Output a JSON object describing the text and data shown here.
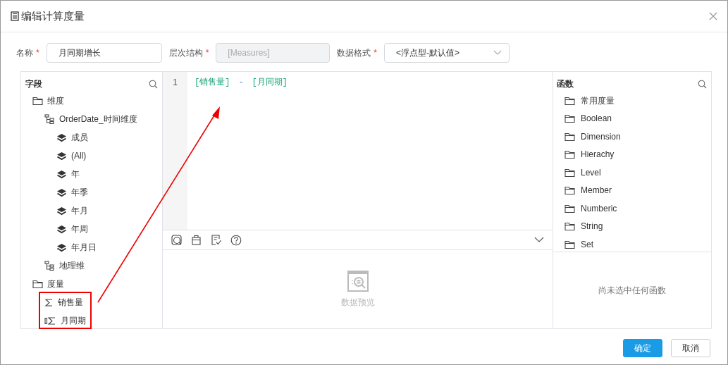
{
  "window": {
    "title": "编辑计算度量"
  },
  "form": [
    {
      "label": "名称",
      "required_mark": "*",
      "kind": "input",
      "value": "月同期增长",
      "disabled": false
    },
    {
      "label": "层次结构",
      "required_mark": "*",
      "kind": "input",
      "value": "[Measures]",
      "disabled": true
    },
    {
      "label": "数据格式",
      "required_mark": "*",
      "kind": "select",
      "value": "<浮点型-默认值>",
      "disabled": false
    }
  ],
  "fields": {
    "title": "字段",
    "tree": [
      {
        "label": "维度",
        "kind": "folder",
        "children": [
          {
            "label": "OrderDate_时间维度",
            "kind": "hierarchy",
            "children": [
              {
                "label": "成员",
                "kind": "level"
              },
              {
                "label": "(All)",
                "kind": "level"
              },
              {
                "label": "年",
                "kind": "level"
              },
              {
                "label": "年季",
                "kind": "level"
              },
              {
                "label": "年月",
                "kind": "level"
              },
              {
                "label": "年周",
                "kind": "level"
              },
              {
                "label": "年月日",
                "kind": "level"
              }
            ]
          },
          {
            "label": "地理维",
            "kind": "hierarchy"
          }
        ]
      },
      {
        "label": "度量",
        "kind": "folder",
        "children": [
          {
            "label": "销售量",
            "kind": "measure"
          },
          {
            "label": "月同期",
            "kind": "calc-measure"
          }
        ]
      }
    ]
  },
  "editor": {
    "lines": [
      {
        "number": "1",
        "tokens": [
          {
            "text": "[销售量]",
            "kind": "field"
          },
          {
            "text": "-",
            "kind": "operator"
          },
          {
            "text": "[月同期]",
            "kind": "field"
          }
        ]
      }
    ],
    "toolbar": [
      {
        "kind": "preview"
      },
      {
        "kind": "format"
      },
      {
        "kind": "check"
      },
      {
        "kind": "help"
      }
    ],
    "preview_label": "数据预览"
  },
  "functions": {
    "title": "函数",
    "items": [
      "常用度量",
      "Boolean",
      "Dimension",
      "Hierachy",
      "Level",
      "Member",
      "Numberic",
      "String",
      "Set"
    ],
    "empty_text": "尚未选中任何函数"
  },
  "buttons": [
    {
      "label": "确定",
      "kind": "primary"
    },
    {
      "label": "取消",
      "kind": "secondary"
    }
  ]
}
